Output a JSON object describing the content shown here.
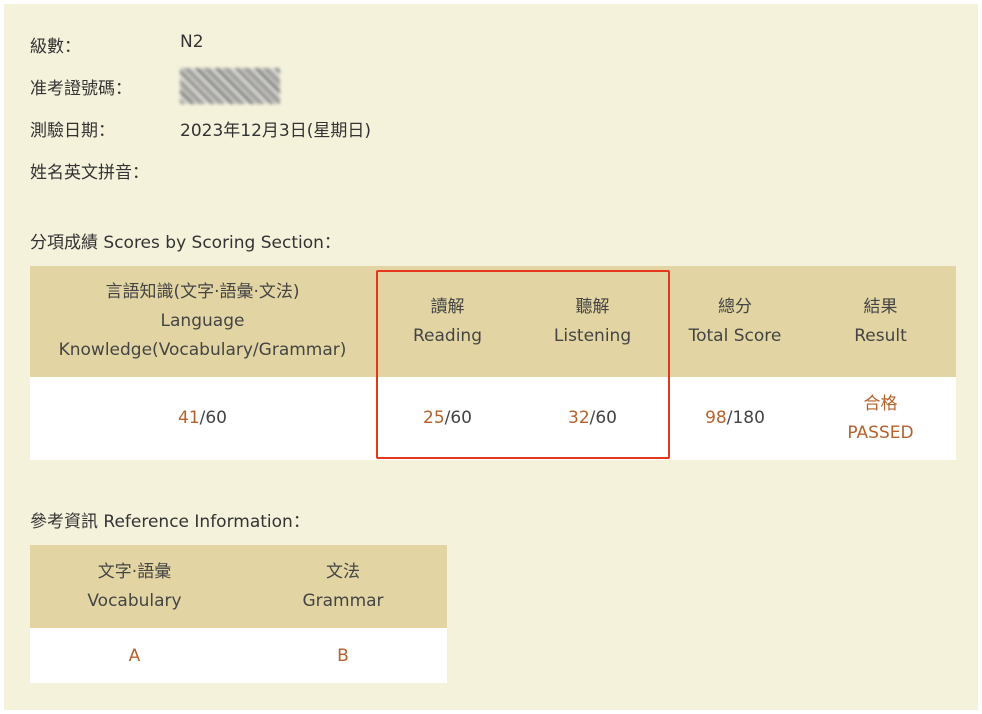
{
  "info": {
    "level_label": "級數：",
    "level_value": "N2",
    "exam_no_label": "准考證號碼：",
    "date_label": "測驗日期：",
    "date_value": "2023年12月3日(星期日)",
    "name_label": "姓名英文拼音："
  },
  "scores_section": {
    "title": "分項成績 Scores by Scoring Section：",
    "headers": [
      {
        "zh": "言語知識(文字·語彙·文法)",
        "en1": "Language",
        "en2": "Knowledge(Vocabulary/Grammar)"
      },
      {
        "zh": "讀解",
        "en": "Reading"
      },
      {
        "zh": "聽解",
        "en": "Listening"
      },
      {
        "zh": "總分",
        "en": "Total Score"
      },
      {
        "zh": "結果",
        "en": "Result"
      }
    ],
    "values": [
      {
        "score": "41",
        "max": "/60"
      },
      {
        "score": "25",
        "max": "/60"
      },
      {
        "score": "32",
        "max": "/60"
      },
      {
        "score": "98",
        "max": "/180"
      },
      {
        "zh": "合格",
        "en": "PASSED"
      }
    ],
    "highlight_color": "#e4371b"
  },
  "reference_section": {
    "title": "參考資訊 Reference Information：",
    "headers": [
      {
        "zh": "文字·語彙",
        "en": "Vocabulary"
      },
      {
        "zh": "文法",
        "en": "Grammar"
      }
    ],
    "values": [
      "A",
      "B"
    ]
  },
  "colors": {
    "background": "#f5f2dc",
    "header_bg": "#e3d5a3",
    "score_accent": "#b5612c"
  }
}
